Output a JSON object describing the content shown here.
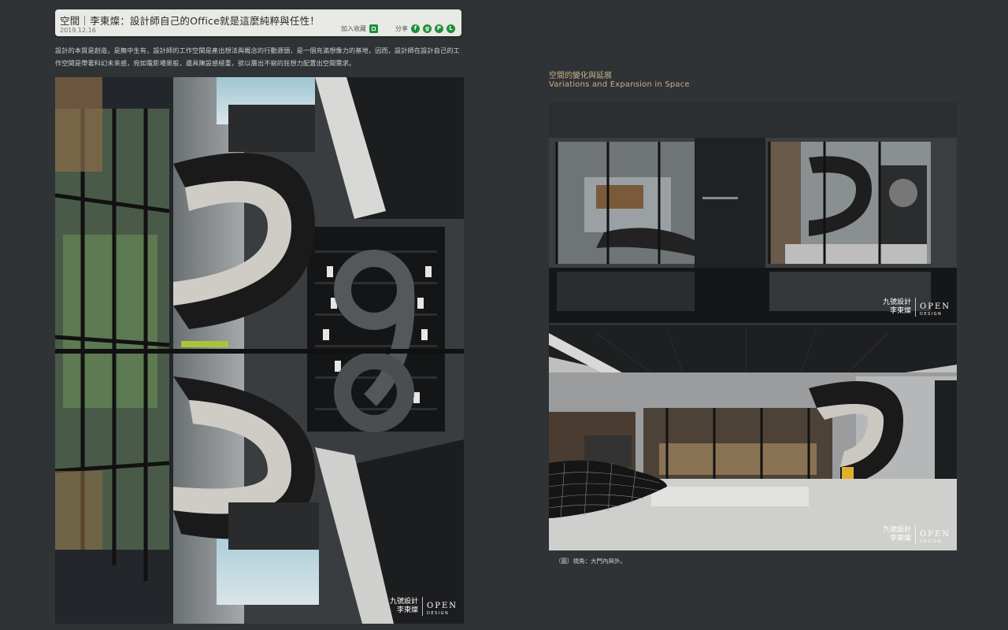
{
  "article": {
    "title": "空間｜李東燦：設計師自己的Office就是這麼純粹與任性！",
    "date": "2019.12.16",
    "add_favorite_label": "加入收藏",
    "share_label": "分享",
    "share_icons": [
      "facebook-icon",
      "google-plus-icon",
      "plurk-icon",
      "line-icon"
    ],
    "intro": "設計的本質是創造，是無中生有，設計師的工作空間是產出想法與概念的行動源頭，是一個充滿想像力的基地，因而，設計師在設計自己的工作空間是帶著科幻未來感，宛如電影場景般，還具陳設感極重，欲以層出不窮的狂想力配置出空間需求。"
  },
  "section": {
    "heading_cn": "空間的變化與延展",
    "heading_en": "Variations and Expansion in Space"
  },
  "watermark": {
    "company": "九號設計",
    "designer": "李東燦",
    "brand": "OPEN",
    "brand_sub": "DESIGN"
  },
  "caption": "（圖）視角：大門內與外。",
  "colors": {
    "background": "#2f3336",
    "header_bg": "#e9e9e6",
    "accent_gold": "#c9b186",
    "share_green": "#1e8f3a"
  }
}
